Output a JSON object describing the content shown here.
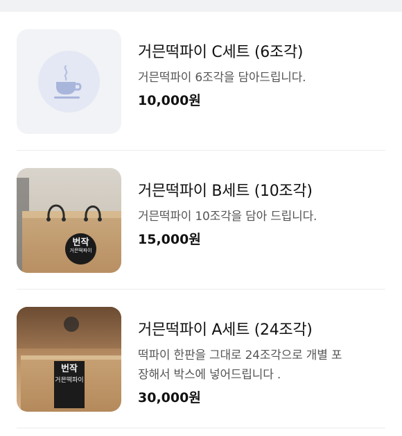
{
  "menu": {
    "items": [
      {
        "name": "거믄떡파이 C세트 (6조각)",
        "description": "거믄떡파이 6조각을 담아드립니다.",
        "price": "10,000원",
        "image": "coffee-cup-placeholder-icon"
      },
      {
        "name": "거믄떡파이 B세트 (10조각)",
        "description": "거믄떡파이 10조각을 담아 드립니다.",
        "price": "15,000원",
        "image": "kraft-gift-box-photo"
      },
      {
        "name": "거믄떡파이 A세트 (24조각)",
        "description": "떡파이 한판을 그대로 24조각으로 개별 포장해서 박스에 넣어드립니다 .",
        "price": "30,000원",
        "image": "kraft-box-tray-photo"
      }
    ]
  },
  "brand": {
    "sticker_main": "번작",
    "sticker_sub": "거믄떡파이"
  },
  "colors": {
    "top_bar": "#f1f2f4",
    "placeholder_bg": "#f2f3f6",
    "placeholder_circle": "#e4e8f4",
    "cup_icon": "#a9b6dc",
    "divider": "#ececec"
  }
}
